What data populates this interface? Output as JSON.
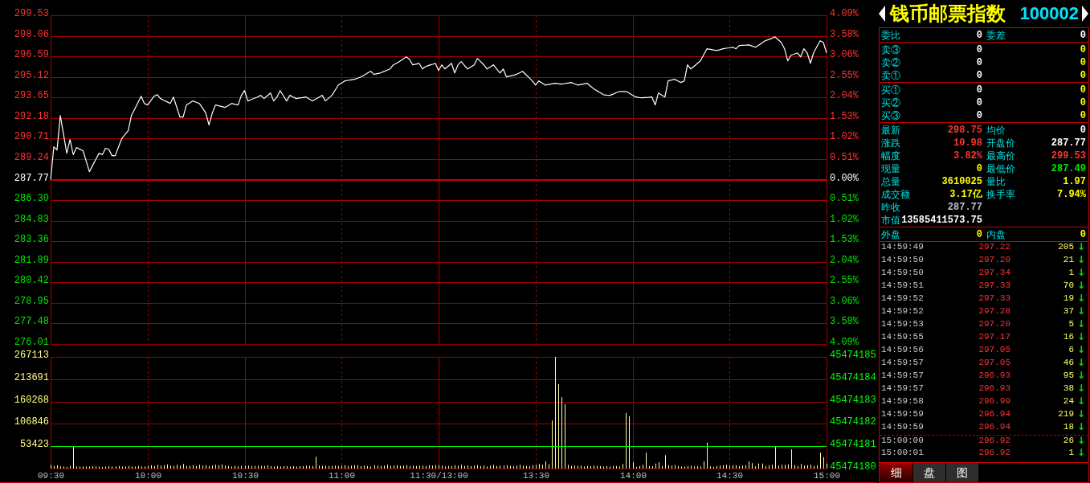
{
  "price_chart": {
    "chart_data": {
      "type": "line",
      "categories": [
        null,
        null,
        null,
        null,
        null,
        null,
        null,
        null,
        null,
        null,
        null,
        null,
        null,
        null,
        null,
        null,
        null,
        null,
        null,
        null,
        null,
        null,
        null,
        null,
        null,
        null,
        null,
        null,
        null,
        null,
        null,
        null,
        null,
        null,
        null,
        null,
        null,
        null,
        null,
        null,
        null,
        null,
        null,
        null,
        null,
        null,
        null,
        null,
        null,
        null,
        null,
        null,
        null,
        null,
        null,
        null,
        null,
        null,
        null,
        null,
        null,
        null,
        null,
        null,
        null,
        null,
        null,
        null,
        null,
        null,
        null,
        null,
        null,
        null,
        null,
        null,
        null,
        null,
        null,
        null,
        null,
        null,
        null,
        null,
        null,
        null,
        null,
        null,
        null,
        null,
        null,
        null,
        null,
        null,
        null,
        null,
        null,
        null,
        null,
        null,
        null,
        null,
        null,
        null,
        null,
        null,
        null,
        null,
        null,
        null,
        null,
        null,
        null,
        null,
        null,
        null,
        null,
        null,
        null,
        null,
        null,
        null,
        null,
        null,
        null,
        null,
        null,
        null,
        null,
        null,
        null,
        null,
        null,
        null,
        null,
        null,
        null,
        null,
        null,
        null,
        null,
        null,
        null,
        null,
        null,
        null,
        null,
        null,
        null,
        null,
        null,
        null,
        null,
        null,
        null,
        null,
        null,
        null,
        null,
        null,
        null,
        null,
        null,
        null,
        null,
        null,
        null,
        null,
        null,
        null,
        null,
        null,
        null,
        null,
        null,
        null,
        null,
        null,
        null,
        null,
        null,
        null,
        null,
        null,
        null,
        null,
        null,
        null,
        null,
        null,
        null,
        null,
        null,
        null,
        null,
        null,
        null,
        null,
        null,
        null,
        null,
        null,
        null,
        null,
        null,
        null,
        null,
        null,
        null,
        null,
        null,
        null,
        null,
        null,
        null,
        null,
        null,
        null,
        null,
        null,
        null,
        null,
        null,
        null,
        null,
        null,
        null,
        null,
        null,
        null,
        null,
        null,
        null,
        null,
        null,
        null,
        null,
        null,
        null,
        null,
        null
      ],
      "series": [
        {
          "color": "#ffffff",
          "values": [
            287.77,
            290.12,
            289.89,
            292.36,
            291.0,
            289.66,
            290.64,
            289.55,
            290.07,
            289.95,
            289.84,
            289.1,
            288.34,
            288.78,
            289.22,
            289.66,
            289.55,
            290.01,
            289.94,
            289.49,
            289.49,
            290.1,
            290.7,
            291.0,
            291.27,
            292.36,
            292.82,
            293.28,
            293.74,
            293.22,
            293.11,
            293.42,
            293.74,
            293.85,
            293.57,
            293.45,
            293.34,
            293.22,
            293.68,
            292.96,
            292.25,
            292.25,
            293.11,
            293.25,
            293.4,
            293.31,
            293.22,
            292.88,
            292.53,
            291.67,
            292.53,
            293.11,
            293.05,
            293.0,
            292.94,
            293.08,
            293.22,
            293.16,
            293.11,
            293.8,
            294.14,
            293.4,
            293.49,
            293.59,
            293.68,
            293.8,
            293.57,
            293.77,
            293.97,
            293.4,
            293.68,
            294.14,
            293.77,
            293.4,
            293.8,
            293.68,
            293.57,
            293.61,
            293.64,
            293.68,
            293.54,
            293.4,
            293.53,
            293.67,
            293.8,
            293.4,
            293.6,
            293.8,
            294.17,
            294.54,
            294.68,
            294.83,
            294.87,
            294.91,
            294.95,
            295.03,
            295.12,
            295.25,
            295.39,
            295.52,
            295.29,
            295.35,
            295.4,
            295.5,
            295.59,
            295.69,
            295.98,
            296.09,
            296.24,
            296.4,
            296.55,
            296.38,
            295.98,
            296.03,
            296.09,
            295.69,
            295.86,
            295.94,
            296.01,
            296.09,
            295.58,
            295.98,
            295.69,
            295.89,
            296.09,
            295.4,
            295.98,
            296.21,
            295.95,
            295.69,
            295.84,
            295.98,
            296.44,
            296.21,
            295.98,
            295.69,
            295.84,
            295.98,
            295.69,
            295.4,
            295.69,
            295.12,
            295.18,
            295.23,
            295.29,
            295.4,
            295.52,
            295.29,
            295.06,
            294.83,
            294.54,
            294.83,
            294.68,
            294.54,
            294.58,
            294.62,
            294.66,
            294.63,
            294.6,
            294.64,
            294.68,
            294.72,
            294.63,
            294.54,
            294.58,
            294.62,
            294.66,
            294.46,
            294.26,
            294.12,
            293.99,
            293.85,
            293.82,
            293.8,
            293.89,
            293.99,
            294.08,
            294.08,
            294.08,
            293.95,
            293.81,
            293.68,
            293.65,
            293.63,
            293.65,
            293.66,
            293.68,
            293.11,
            293.97,
            293.82,
            293.68,
            294.83,
            294.89,
            294.95,
            294.83,
            294.72,
            294.83,
            295.98,
            295.69,
            295.88,
            296.08,
            296.27,
            296.7,
            297.13,
            297.09,
            297.05,
            297.01,
            297.07,
            297.13,
            297.17,
            297.2,
            297.24,
            297.13,
            297.36,
            297.38,
            297.39,
            297.41,
            297.32,
            297.24,
            297.39,
            297.55,
            297.7,
            297.78,
            297.87,
            297.99,
            297.79,
            297.59,
            297.13,
            296.27,
            296.67,
            296.75,
            296.84,
            296.55,
            297.13,
            296.84,
            296.09,
            296.84,
            297.27,
            297.7,
            297.59,
            296.84
          ]
        }
      ],
      "ylim": [
        276.01,
        299.53
      ],
      "yticks": [
        {
          "value": 299.53,
          "label": "299.53"
        },
        {
          "value": 298.06,
          "label": "298.06"
        },
        {
          "value": 296.59,
          "label": "296.59"
        },
        {
          "value": 295.12,
          "label": "295.12"
        },
        {
          "value": 293.65,
          "label": "293.65"
        },
        {
          "value": 292.18,
          "label": "292.18"
        },
        {
          "value": 290.71,
          "label": "290.71"
        },
        {
          "value": 289.24,
          "label": "289.24"
        },
        {
          "value": 287.77,
          "label": "287.77"
        },
        {
          "value": 286.3,
          "label": "286.30"
        },
        {
          "value": 284.83,
          "label": "284.83"
        },
        {
          "value": 283.36,
          "label": "283.36"
        },
        {
          "value": 281.89,
          "label": "281.89"
        },
        {
          "value": 280.42,
          "label": "280.42"
        },
        {
          "value": 278.95,
          "label": "278.95"
        },
        {
          "value": 277.48,
          "label": "277.48"
        },
        {
          "value": 276.01,
          "label": "276.01"
        }
      ],
      "grid": true,
      "ref_lines": [
        {
          "axis": "y",
          "value": 287.77
        }
      ]
    },
    "right_axis_labels": [
      "4.09%",
      "3.58%",
      "3.06%",
      "2.55%",
      "2.04%",
      "1.53%",
      "1.02%",
      "0.51%",
      "0.00%",
      "0.51%",
      "1.02%",
      "1.53%",
      "2.04%",
      "2.55%",
      "3.06%",
      "3.58%",
      "4.09%"
    ]
  },
  "volume_chart": {
    "chart_data": {
      "type": "bar",
      "categories": [
        "09:30",
        null,
        null,
        null,
        null,
        null,
        null,
        null,
        null,
        null,
        null,
        null,
        null,
        null,
        null,
        null,
        null,
        null,
        null,
        null,
        null,
        null,
        null,
        null,
        null,
        null,
        null,
        null,
        null,
        null,
        "10:00",
        null,
        null,
        null,
        null,
        null,
        null,
        null,
        null,
        null,
        null,
        null,
        null,
        null,
        null,
        null,
        null,
        null,
        null,
        null,
        null,
        null,
        null,
        null,
        null,
        null,
        null,
        null,
        null,
        null,
        "10:30",
        null,
        null,
        null,
        null,
        null,
        null,
        null,
        null,
        null,
        null,
        null,
        null,
        null,
        null,
        null,
        null,
        null,
        null,
        null,
        null,
        null,
        null,
        null,
        null,
        null,
        null,
        null,
        null,
        null,
        "11:00",
        null,
        null,
        null,
        null,
        null,
        null,
        null,
        null,
        null,
        null,
        null,
        null,
        null,
        null,
        null,
        null,
        null,
        null,
        null,
        null,
        null,
        null,
        null,
        null,
        null,
        null,
        null,
        null,
        null,
        "11:30/13:00",
        null,
        null,
        null,
        null,
        null,
        null,
        null,
        null,
        null,
        null,
        null,
        null,
        null,
        null,
        null,
        null,
        null,
        null,
        null,
        null,
        null,
        null,
        null,
        null,
        null,
        null,
        null,
        null,
        null,
        "13:30",
        null,
        null,
        null,
        null,
        null,
        null,
        null,
        null,
        null,
        null,
        null,
        null,
        null,
        null,
        null,
        null,
        null,
        null,
        null,
        null,
        null,
        null,
        null,
        null,
        null,
        null,
        null,
        null,
        null,
        "14:00",
        null,
        null,
        null,
        null,
        null,
        null,
        null,
        null,
        null,
        null,
        null,
        null,
        null,
        null,
        null,
        null,
        null,
        null,
        null,
        null,
        null,
        null,
        null,
        null,
        null,
        null,
        null,
        null,
        null,
        "14:30",
        null,
        null,
        null,
        null,
        null,
        null,
        null,
        null,
        null,
        null,
        null,
        null,
        null,
        null,
        null,
        null,
        null,
        null,
        null,
        null,
        null,
        null,
        null,
        null,
        null,
        null,
        null,
        null,
        null,
        "15:00"
      ],
      "series": [
        {
          "color": "#ffff99",
          "values": [
            9000,
            6000,
            8000,
            5000,
            5000,
            4000,
            6000,
            53000,
            5000,
            5000,
            5000,
            5000,
            5000,
            6000,
            5000,
            5000,
            4000,
            5000,
            6000,
            5000,
            5000,
            6000,
            5000,
            5000,
            6000,
            5000,
            5000,
            6000,
            5000,
            5000,
            6000,
            8000,
            6000,
            9000,
            7000,
            8000,
            10000,
            7000,
            6000,
            9000,
            7000,
            11000,
            6000,
            7000,
            8000,
            6000,
            9000,
            7000,
            8000,
            6000,
            7000,
            9000,
            8000,
            10000,
            7000,
            6000,
            5000,
            6000,
            5000,
            6000,
            6000,
            7000,
            6000,
            6000,
            7000,
            6000,
            6000,
            8000,
            6000,
            5000,
            6000,
            5000,
            6000,
            6000,
            5000,
            6000,
            5000,
            6000,
            6000,
            7000,
            6000,
            6000,
            28000,
            7000,
            6000,
            7000,
            6000,
            6000,
            7000,
            6000,
            7000,
            8000,
            6000,
            7000,
            8000,
            8000,
            6000,
            7000,
            6000,
            5000,
            8000,
            7000,
            6000,
            7000,
            9000,
            6000,
            7000,
            8000,
            6000,
            7000,
            8000,
            6000,
            7000,
            6000,
            7000,
            7000,
            6000,
            8000,
            7000,
            8000,
            8000,
            7000,
            5000,
            6000,
            6000,
            8000,
            7000,
            9000,
            6000,
            7000,
            6000,
            7000,
            8000,
            6000,
            7000,
            5000,
            7000,
            9000,
            6000,
            7000,
            7000,
            8000,
            6000,
            6000,
            7000,
            9000,
            7000,
            6000,
            6000,
            8000,
            8000,
            11000,
            9000,
            17000,
            11000,
            115000,
            267000,
            202000,
            171000,
            154000,
            9000,
            6000,
            7000,
            6000,
            7000,
            5000,
            6000,
            6000,
            7000,
            6000,
            6000,
            5000,
            6000,
            5000,
            6000,
            6000,
            5000,
            11000,
            133000,
            125000,
            15000,
            4000,
            6000,
            9000,
            38000,
            6000,
            6000,
            12000,
            15000,
            6000,
            32000,
            8000,
            7000,
            8000,
            6000,
            5000,
            5000,
            6000,
            7000,
            5000,
            6000,
            5000,
            17000,
            62000,
            5000,
            4000,
            6000,
            7000,
            8000,
            9000,
            7000,
            8000,
            8000,
            6000,
            7000,
            8000,
            17000,
            13000,
            5000,
            12000,
            12000,
            6000,
            8000,
            9000,
            52000,
            7000,
            9000,
            9000,
            10000,
            46000,
            8000,
            6000,
            11000,
            7000,
            8000,
            9000,
            6000,
            8000,
            38000,
            27000,
            12000
          ]
        }
      ],
      "ylim": [
        0,
        267113
      ],
      "yticks": [
        {
          "value": 267113,
          "label": "267113"
        },
        {
          "value": 213691,
          "label": "213691"
        },
        {
          "value": 160268,
          "label": "160268"
        },
        {
          "value": 106846,
          "label": "106846"
        },
        {
          "value": 53423,
          "label": "53423"
        }
      ],
      "grid": true,
      "ref_lines": [
        {
          "axis": "y",
          "value": 53423,
          "color": "#00ff00"
        }
      ]
    },
    "right_axis_labels": [
      "45474185",
      "45474184",
      "45474183",
      "45474182",
      "45474181",
      "45474180"
    ]
  },
  "quote_panel": {
    "title": "钱币邮票指数",
    "code": "100002",
    "sections": [
      {
        "rows": [
          [
            {
              "label": "委比",
              "value": "0",
              "color": "#ffffff"
            },
            {
              "label": "委差",
              "value": "0",
              "color": "#ffffff"
            }
          ]
        ]
      },
      {
        "rows": [
          [
            {
              "label": "卖③",
              "value": "0",
              "color": "#ffffff"
            },
            {
              "value": "0",
              "color": "#ffff00"
            }
          ],
          [
            {
              "label": "卖②",
              "value": "0",
              "color": "#ffffff"
            },
            {
              "value": "0",
              "color": "#ffff00"
            }
          ],
          [
            {
              "label": "卖①",
              "value": "0",
              "color": "#ffffff"
            },
            {
              "value": "0",
              "color": "#ffff00"
            }
          ]
        ]
      },
      {
        "rows": [
          [
            {
              "label": "买①",
              "value": "0",
              "color": "#ffffff"
            },
            {
              "value": "0",
              "color": "#ffff00"
            }
          ],
          [
            {
              "label": "买②",
              "value": "0",
              "color": "#ffffff"
            },
            {
              "value": "0",
              "color": "#ffff00"
            }
          ],
          [
            {
              "label": "买③",
              "value": "0",
              "color": "#ffffff"
            },
            {
              "value": "0",
              "color": "#ffff00"
            }
          ]
        ]
      },
      {
        "rows": [
          [
            {
              "label": "最新",
              "value": "298.75",
              "color": "#ff3232"
            },
            {
              "label": "均价",
              "value": "0",
              "color": "#ffffff"
            }
          ],
          [
            {
              "label": "涨跌",
              "value": "10.98",
              "color": "#ff3232"
            },
            {
              "label": "开盘价",
              "value": "287.77",
              "color": "#ffffff"
            }
          ],
          [
            {
              "label": "幅度",
              "value": "3.82%",
              "color": "#ff3232"
            },
            {
              "label": "最高价",
              "value": "299.53",
              "color": "#ff3232"
            }
          ],
          [
            {
              "label": "现量",
              "value": "0",
              "color": "#ffff00"
            },
            {
              "label": "最低价",
              "value": "287.49",
              "color": "#00e600"
            }
          ],
          [
            {
              "label": "总量",
              "value": "3610025",
              "color": "#ffff00"
            },
            {
              "label": "量比",
              "value": "1.97",
              "color": "#ffff00"
            }
          ],
          [
            {
              "label": "成交额",
              "value": "3.17亿",
              "color": "#ffff00"
            },
            {
              "label": "换手率",
              "value": "7.94%",
              "color": "#ffff00"
            }
          ],
          [
            {
              "label": "昨收",
              "value": "287.77",
              "color": "#c0c0c0"
            }
          ],
          [
            {
              "label": "市值",
              "value": "13585411573.75",
              "color": "#ffffff"
            }
          ]
        ]
      },
      {
        "rows": [
          [
            {
              "label": "外盘",
              "value": "0",
              "color": "#ffff00"
            },
            {
              "label": "内盘",
              "value": "0",
              "color": "#ffff00"
            }
          ]
        ]
      }
    ],
    "trades": [
      {
        "time": "14:59:49",
        "price": "297.22",
        "volume": "205",
        "arrow": "↓",
        "session_break_above": false
      },
      {
        "time": "14:59:50",
        "price": "297.20",
        "volume": "21",
        "arrow": "↓",
        "session_break_above": false
      },
      {
        "time": "14:59:50",
        "price": "297.34",
        "volume": "1",
        "arrow": "↓",
        "session_break_above": false
      },
      {
        "time": "14:59:51",
        "price": "297.33",
        "volume": "70",
        "arrow": "↓",
        "session_break_above": false
      },
      {
        "time": "14:59:52",
        "price": "297.33",
        "volume": "19",
        "arrow": "↓",
        "session_break_above": false
      },
      {
        "time": "14:59:52",
        "price": "297.28",
        "volume": "37",
        "arrow": "↓",
        "session_break_above": false
      },
      {
        "time": "14:59:53",
        "price": "297.20",
        "volume": "5",
        "arrow": "↓",
        "session_break_above": false
      },
      {
        "time": "14:59:55",
        "price": "297.17",
        "volume": "16",
        "arrow": "↓",
        "session_break_above": false
      },
      {
        "time": "14:59:56",
        "price": "297.05",
        "volume": "6",
        "arrow": "↓",
        "session_break_above": false
      },
      {
        "time": "14:59:57",
        "price": "297.05",
        "volume": "46",
        "arrow": "↓",
        "session_break_above": false
      },
      {
        "time": "14:59:57",
        "price": "296.93",
        "volume": "95",
        "arrow": "↓",
        "session_break_above": false
      },
      {
        "time": "14:59:57",
        "price": "296.93",
        "volume": "38",
        "arrow": "↓",
        "session_break_above": false
      },
      {
        "time": "14:59:58",
        "price": "296.99",
        "volume": "24",
        "arrow": "↓",
        "session_break_above": false
      },
      {
        "time": "14:59:59",
        "price": "296.94",
        "volume": "219",
        "arrow": "↓",
        "session_break_above": false
      },
      {
        "time": "14:59:59",
        "price": "296.94",
        "volume": "18",
        "arrow": "↓",
        "session_break_above": false
      },
      {
        "time": "15:00:00",
        "price": "296.92",
        "volume": "26",
        "arrow": "↓",
        "session_break_above": true
      },
      {
        "time": "15:00:01",
        "price": "296.92",
        "volume": "1",
        "arrow": "↓",
        "session_break_above": false
      }
    ],
    "tabs": [
      {
        "label": "细",
        "selected": true
      },
      {
        "label": "盘",
        "selected": false
      },
      {
        "label": "图",
        "selected": false
      }
    ]
  }
}
